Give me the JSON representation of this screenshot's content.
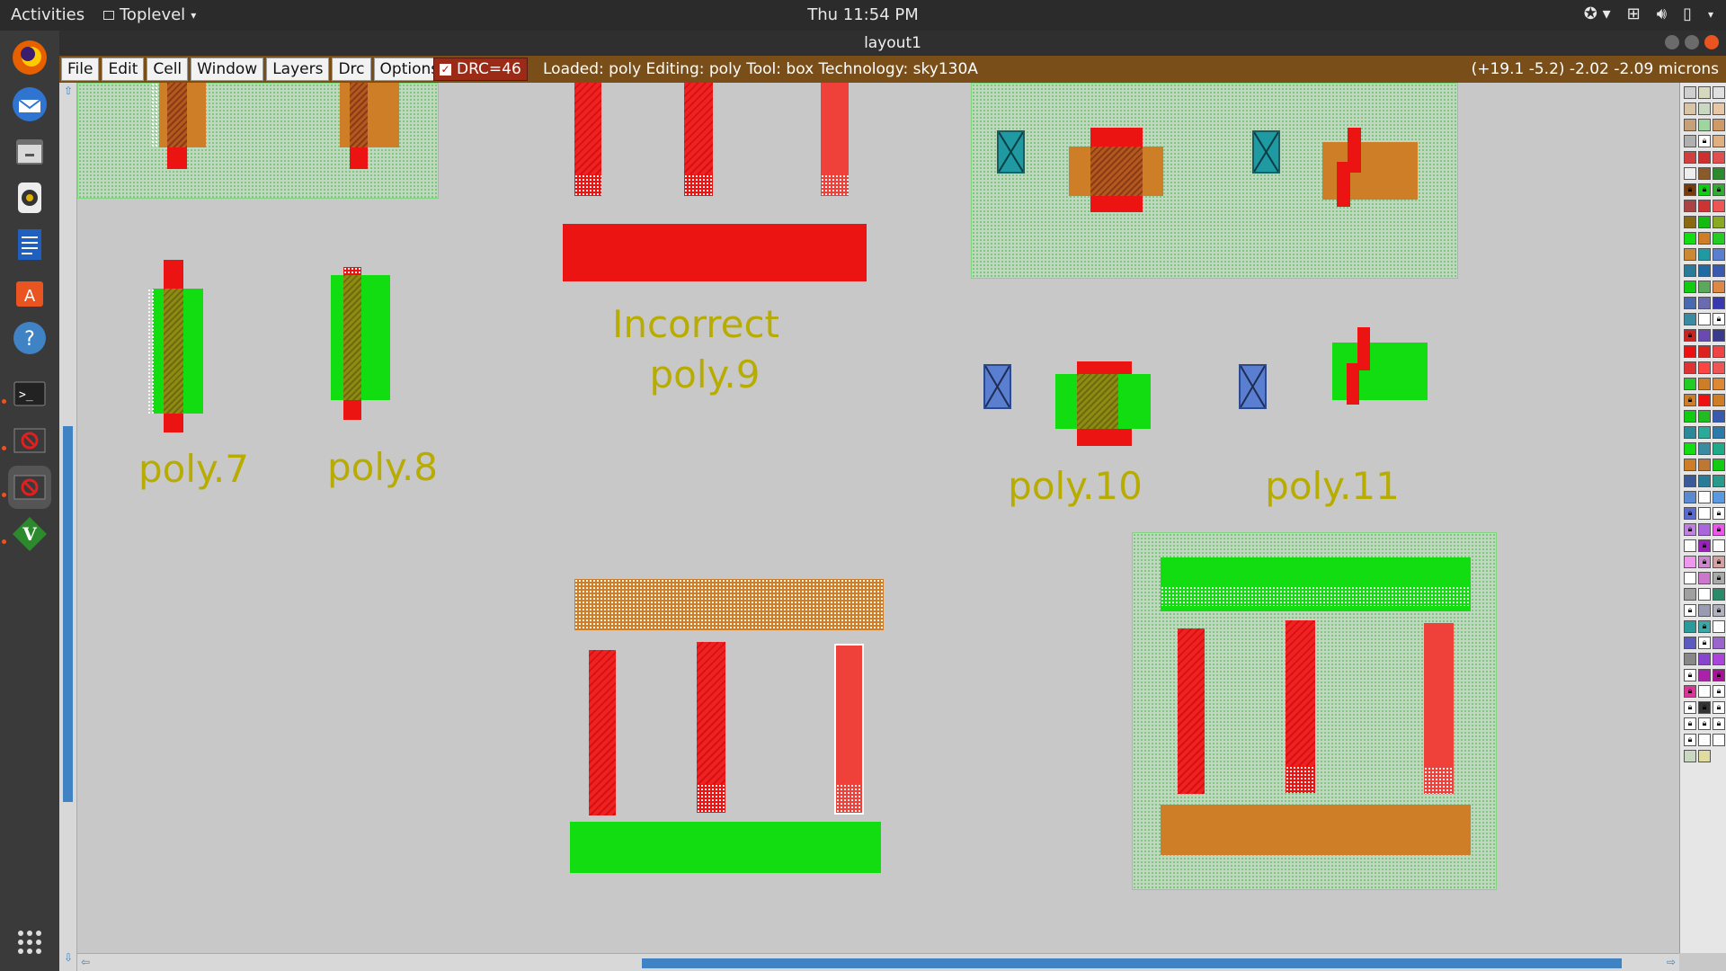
{
  "topbar": {
    "activities": "Activities",
    "app_menu": "Toplevel",
    "clock": "Thu 11:54 PM"
  },
  "window": {
    "title": "layout1"
  },
  "menubar": {
    "menus": [
      "File",
      "Edit",
      "Cell",
      "Window",
      "Layers",
      "Drc",
      "Options"
    ],
    "drc": "DRC=46",
    "status": "Loaded: poly Editing: poly Tool: box  Technology: sky130A",
    "coords": "(+19.1 -5.2) -2.02 -2.09 microns"
  },
  "canvas": {
    "labels": {
      "poly7": "poly.7",
      "poly8": "poly.8",
      "incorrect_line1": "Incorrect",
      "incorrect_line2": "poly.9",
      "poly10": "poly.10",
      "poly11": "poly.11"
    }
  },
  "colors": {
    "label": "#b8ac00",
    "poly": "#ec1313",
    "diff_brown": "#cd7e26",
    "diff_green": "#11dd11",
    "nwell": "#bfd8bf",
    "menubar": "#7a4e18"
  },
  "dock": {
    "icons": [
      "firefox-icon",
      "thunderbird-icon",
      "files-icon",
      "rhythmbox-icon",
      "writer-icon",
      "software-icon",
      "help-icon",
      "terminal-icon",
      "app-icon-1",
      "app-icon-2",
      "vim-icon",
      "show-apps-icon"
    ]
  }
}
